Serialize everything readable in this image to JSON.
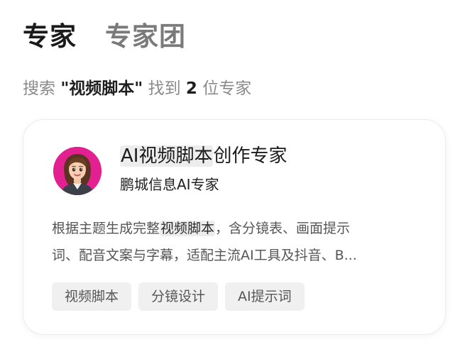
{
  "tabs": [
    {
      "label": "专家",
      "active": true
    },
    {
      "label": "专家团",
      "active": false
    }
  ],
  "search_summary": {
    "prefix": "搜索",
    "query": "\"视频脚本\"",
    "middle": "找到",
    "count": "2",
    "suffix": "位专家"
  },
  "card": {
    "avatar_icon": "female-assistant-avatar",
    "title_highlight": "AI视频脚本",
    "title_rest": "创作专家",
    "subtitle": "鹏城信息AI专家",
    "desc_line1_before": "根据主题生成完整",
    "desc_line1_highlight": "视频脚本",
    "desc_line1_after": "，含分镜表、画面提示",
    "desc_line2": "词、配音文案与字幕，适配主流AI工具及抖音、B...",
    "tags": [
      "视频脚本",
      "分镜设计",
      "AI提示词"
    ]
  },
  "colors": {
    "avatar_bg": "#e3208f",
    "highlight_bg": "#ededed",
    "tag_bg": "#f0f0f0"
  }
}
